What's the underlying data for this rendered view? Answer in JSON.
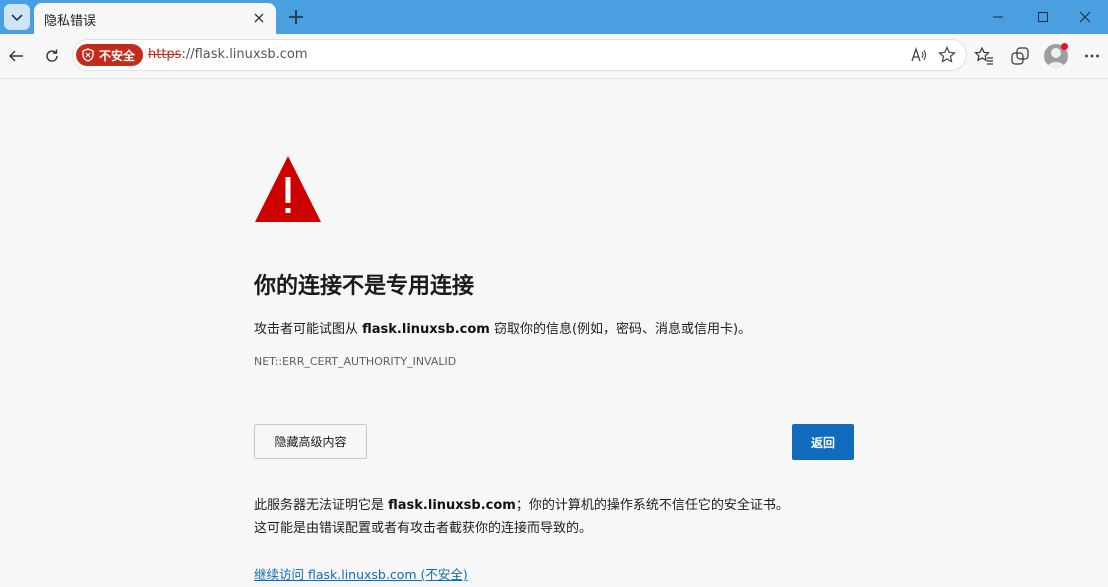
{
  "tab": {
    "title": "隐私错误"
  },
  "addressbar": {
    "security_label": "不安全",
    "url_scheme": "https",
    "url_rest": "://flask.linuxsb.com"
  },
  "icons": {
    "tab_menu": "chevron-down-icon",
    "tab_close": "close-icon",
    "new_tab": "plus-icon",
    "minimize": "minimize-icon",
    "maximize": "maximize-icon",
    "close_window": "close-icon",
    "back": "back-arrow-icon",
    "refresh": "refresh-icon",
    "security": "shield-warning-icon",
    "read_aloud": "read-aloud-icon",
    "favorite": "star-icon",
    "favorites": "favorites-icon",
    "collections": "collections-icon",
    "profile": "avatar-icon",
    "more": "more-icon",
    "warning": "warning-triangle-icon"
  },
  "colors": {
    "titlebar": "#4a9fe0",
    "danger": "#c42b1c",
    "warning_red": "#cc0000",
    "primary": "#0f6cbd"
  },
  "content": {
    "heading": "你的连接不是专用连接",
    "desc_prefix": "攻击者可能试图从 ",
    "desc_host": "flask.linuxsb.com",
    "desc_suffix": " 窃取你的信息(例如，密码、消息或信用卡)。",
    "error_code": "NET::ERR_CERT_AUTHORITY_INVALID",
    "hide_advanced_label": "隐藏高级内容",
    "back_label": "返回",
    "explain_prefix": "此服务器无法证明它是 ",
    "explain_host": "flask.linuxsb.com",
    "explain_suffix": "；你的计算机的操作系统不信任它的安全证书。",
    "explain_line2": "这可能是由错误配置或者有攻击者截获你的连接而导致的。",
    "proceed_link": "继续访问 flask.linuxsb.com (不安全)"
  }
}
